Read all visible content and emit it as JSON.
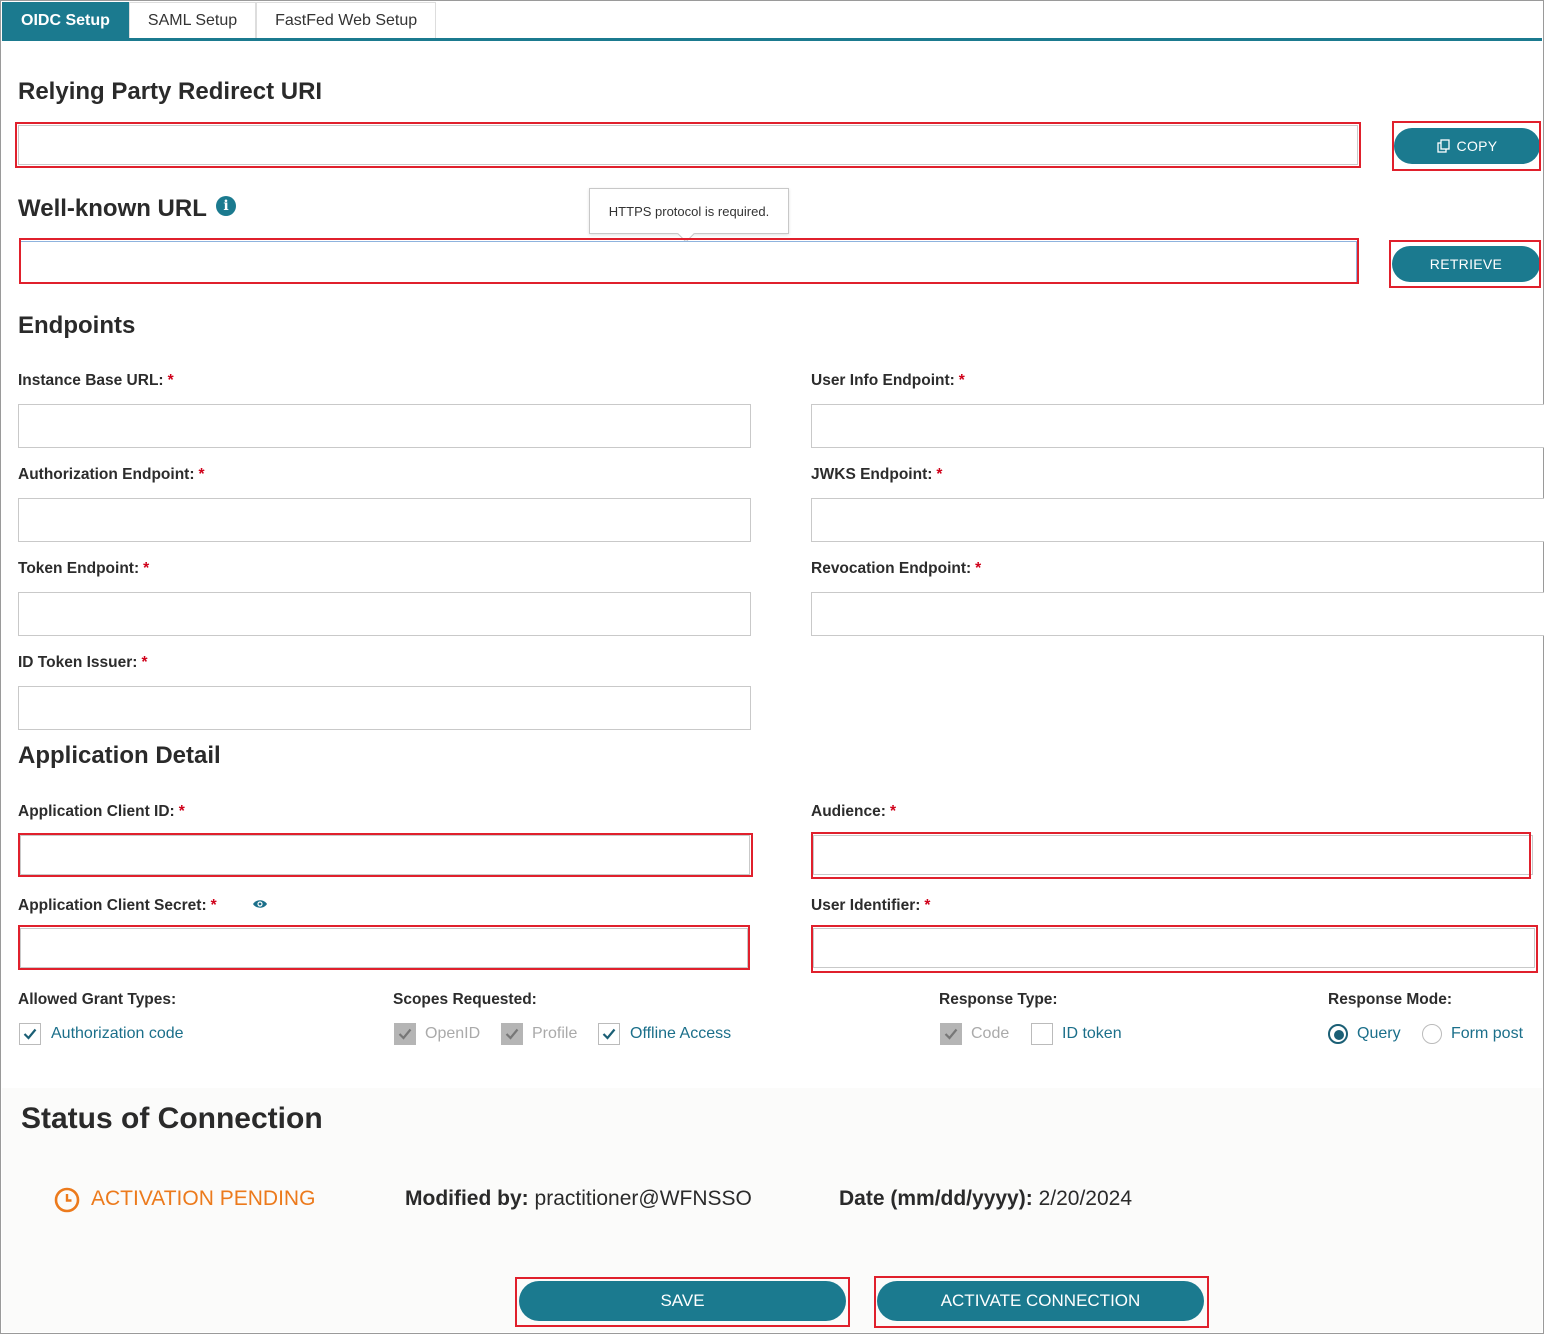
{
  "tabs": [
    "OIDC Setup",
    "SAML Setup",
    "FastFed Web Setup"
  ],
  "relying_party": {
    "title": "Relying Party Redirect URI",
    "copy_label": "COPY"
  },
  "well_known": {
    "title": "Well-known URL",
    "retrieve_label": "RETRIEVE",
    "tooltip": "HTTPS protocol is required."
  },
  "endpoints": {
    "title": "Endpoints",
    "instance_base_url": "Instance Base URL:",
    "user_info_endpoint": "User Info Endpoint:",
    "authorization_endpoint": "Authorization Endpoint:",
    "jwks_endpoint": "JWKS Endpoint:",
    "token_endpoint": "Token Endpoint:",
    "revocation_endpoint": "Revocation Endpoint:",
    "id_token_issuer": "ID Token Issuer:"
  },
  "application_detail": {
    "title": "Application Detail",
    "client_id": "Application Client ID:",
    "audience": "Audience:",
    "client_secret": "Application Client Secret:",
    "user_identifier": "User Identifier:"
  },
  "grant_types": {
    "title": "Allowed Grant Types:",
    "authorization_code": "Authorization code"
  },
  "scopes": {
    "title": "Scopes Requested:",
    "openid": "OpenID",
    "profile": "Profile",
    "offline_access": "Offline Access"
  },
  "response_type": {
    "title": "Response Type:",
    "code": "Code",
    "id_token": "ID token"
  },
  "response_mode": {
    "title": "Response Mode:",
    "query": "Query",
    "form_post": "Form post"
  },
  "status": {
    "title": "Status of Connection",
    "state": "ACTIVATION PENDING",
    "modified_by_label": "Modified by",
    "modified_by_value": "practitioner@WFNSSO",
    "date_label": "Date (mm/dd/yyyy)",
    "date_value": "2/20/2024"
  },
  "actions": {
    "save": "SAVE",
    "activate": "ACTIVATE CONNECTION"
  },
  "colors": {
    "accent": "#1b7a8f",
    "highlight": "#e0202c",
    "pending": "#ec7a1c",
    "required": "#d0021b"
  },
  "icons": [
    "copy-icon",
    "info-icon",
    "eye-icon",
    "check-icon",
    "clock-icon"
  ]
}
